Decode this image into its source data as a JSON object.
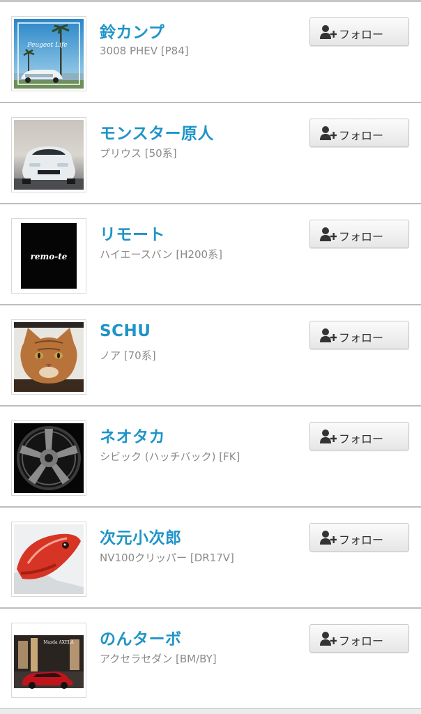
{
  "follow_list": {
    "users": [
      {
        "name": "鈴カンプ",
        "car": "3008 PHEV [P84]",
        "avatar_icon": "car-at-seaside-photo",
        "avatar_caption": "Peugeot Life"
      },
      {
        "name": "モンスター原人",
        "car": "プリウス [50系]",
        "avatar_icon": "white-car-front-photo"
      },
      {
        "name": "リモート",
        "car": "ハイエースバン [H200系]",
        "avatar_icon": "remo-te-logo",
        "avatar_caption": "remo-te"
      },
      {
        "name": "SCHU",
        "car": "ノア [70系]",
        "avatar_icon": "cat-photo"
      },
      {
        "name": "ネオタカ",
        "car": "シビック (ハッチバック) [FK]",
        "avatar_icon": "wheel-rim-photo"
      },
      {
        "name": "次元小次郎",
        "car": "NV100クリッパー [DR17V]",
        "avatar_icon": "red-fish-photo"
      },
      {
        "name": "のんターボ",
        "car": "アクセラセダン [BM/BY]",
        "avatar_icon": "red-car-night-photo",
        "avatar_caption": "Mazda AXELA"
      }
    ],
    "follow_button_label": "フォロー",
    "follow_icon": "user-add-icon"
  },
  "colors": {
    "username": "#1e94c8",
    "car_text": "#8a8a8a",
    "separator": "#bdbdbd",
    "button_text": "#333333"
  }
}
